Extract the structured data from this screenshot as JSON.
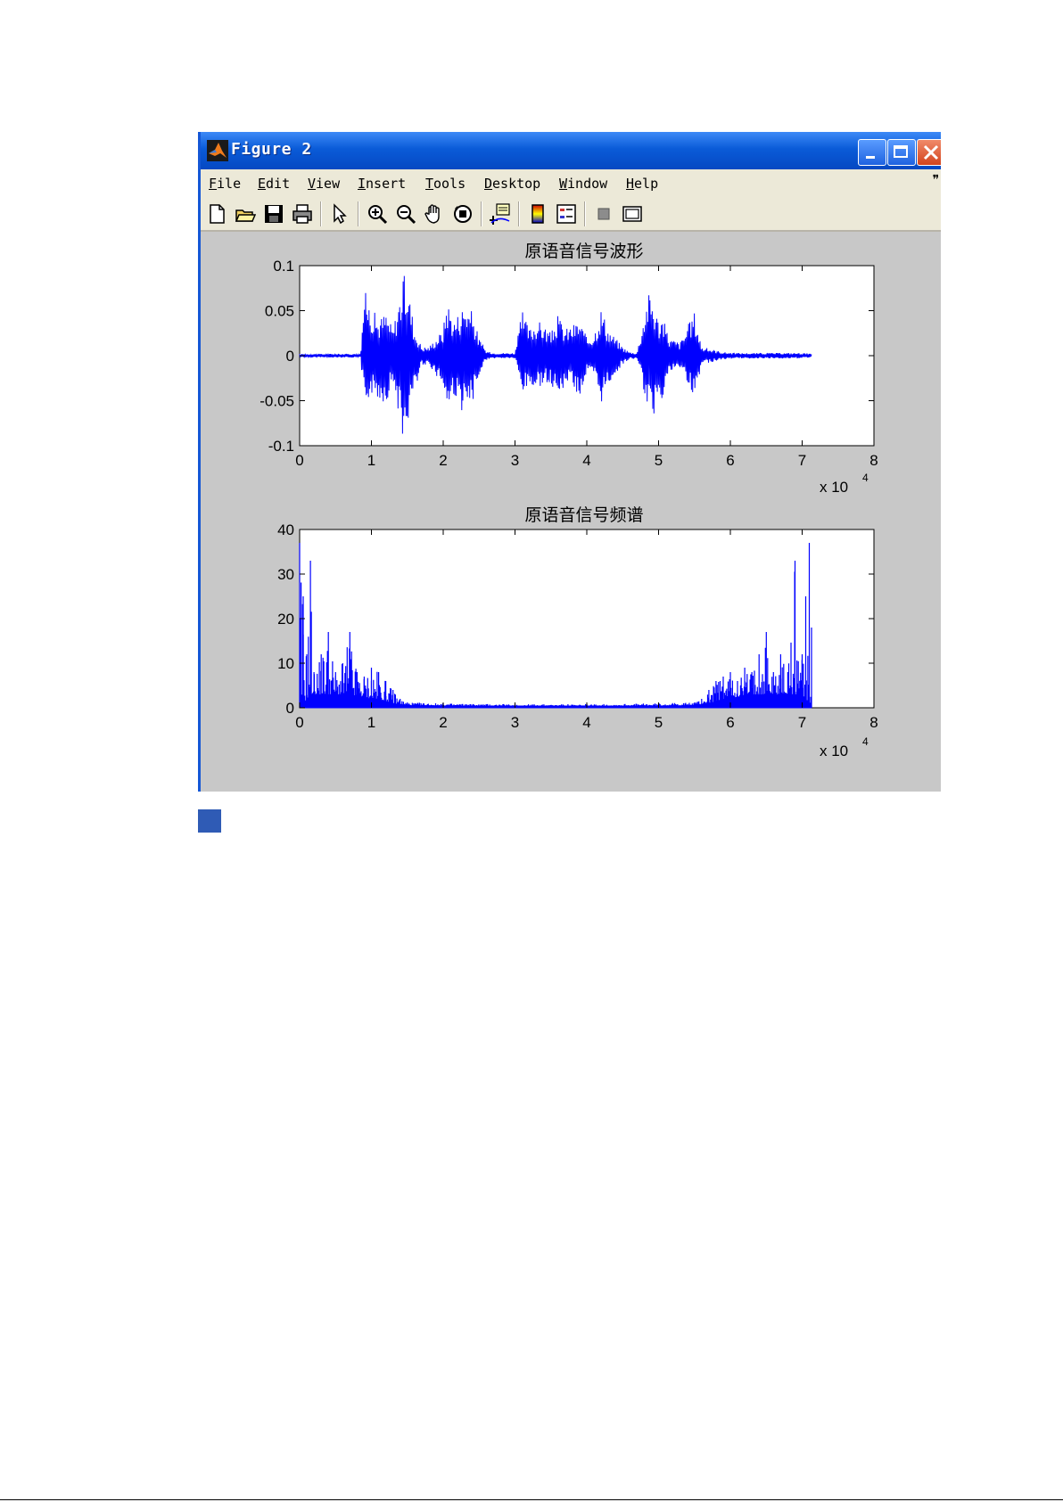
{
  "window": {
    "title": "Figure 2",
    "menu": [
      "File",
      "Edit",
      "View",
      "Insert",
      "Tools",
      "Desktop",
      "Window",
      "Help"
    ],
    "menu_more": "❞",
    "toolbar_icons": [
      "new-figure-icon",
      "open-file-icon",
      "save-icon",
      "print-icon",
      "edit-plot-arrow-icon",
      "zoom-in-icon",
      "zoom-out-icon",
      "pan-hand-icon",
      "rotate-3d-icon",
      "data-cursor-icon",
      "colorbar-icon",
      "legend-icon",
      "hide-plot-tools-icon",
      "show-plot-tools-icon"
    ]
  },
  "colors": {
    "line": "#0000ff",
    "titlebar": "#0a5bd8",
    "figure_bg": "#c8c8c8",
    "menu_bg": "#ece9d8"
  },
  "chart_data": [
    {
      "type": "line",
      "title": "原语音信号波形",
      "xlabel": "",
      "ylabel": "",
      "xlim": [
        0,
        8
      ],
      "ylim": [
        -0.1,
        0.1
      ],
      "xticks": [
        "0",
        "1",
        "2",
        "3",
        "4",
        "5",
        "6",
        "7",
        "8"
      ],
      "yticks": [
        "-0.1",
        "-0.05",
        "0",
        "0.05",
        "0.1"
      ],
      "x_multiplier": "x 10",
      "x_multiplier_exp": "4",
      "envelope": {
        "x": [
          0,
          0.85,
          0.9,
          1.0,
          1.1,
          1.2,
          1.3,
          1.45,
          1.5,
          1.6,
          1.7,
          1.8,
          2.0,
          2.05,
          2.15,
          2.3,
          2.4,
          2.5,
          2.6,
          2.7,
          3.0,
          3.1,
          3.2,
          3.3,
          3.4,
          3.5,
          3.6,
          3.7,
          3.8,
          3.9,
          4.0,
          4.1,
          4.2,
          4.3,
          4.4,
          4.5,
          4.6,
          4.7,
          4.85,
          4.9,
          5.0,
          5.05,
          5.15,
          5.3,
          5.5,
          5.6,
          5.75,
          5.9,
          6.1,
          6.5,
          7.0,
          7.13
        ],
        "upper": [
          0.002,
          0.002,
          0.075,
          0.055,
          0.04,
          0.05,
          0.03,
          0.09,
          0.085,
          0.03,
          0.01,
          0.01,
          0.03,
          0.065,
          0.04,
          0.06,
          0.05,
          0.02,
          0.005,
          0.003,
          0.003,
          0.05,
          0.03,
          0.04,
          0.035,
          0.025,
          0.045,
          0.03,
          0.035,
          0.04,
          0.02,
          0.025,
          0.055,
          0.03,
          0.02,
          0.01,
          0.004,
          0.003,
          0.07,
          0.07,
          0.04,
          0.045,
          0.02,
          0.015,
          0.05,
          0.01,
          0.007,
          0.004,
          0.003,
          0.003,
          0.003,
          0.002
        ],
        "lower": [
          -0.002,
          -0.002,
          -0.055,
          -0.045,
          -0.05,
          -0.055,
          -0.03,
          -0.095,
          -0.08,
          -0.04,
          -0.01,
          -0.01,
          -0.035,
          -0.065,
          -0.045,
          -0.07,
          -0.055,
          -0.02,
          -0.005,
          -0.003,
          -0.003,
          -0.045,
          -0.035,
          -0.04,
          -0.03,
          -0.03,
          -0.05,
          -0.03,
          -0.03,
          -0.05,
          -0.02,
          -0.025,
          -0.055,
          -0.035,
          -0.02,
          -0.01,
          -0.004,
          -0.003,
          -0.06,
          -0.085,
          -0.04,
          -0.05,
          -0.02,
          -0.015,
          -0.045,
          -0.01,
          -0.007,
          -0.004,
          -0.003,
          -0.003,
          -0.003,
          -0.002
        ]
      }
    },
    {
      "type": "line",
      "title": "原语音信号频谱",
      "xlabel": "",
      "ylabel": "",
      "xlim": [
        0,
        8
      ],
      "ylim": [
        0,
        40
      ],
      "xticks": [
        "0",
        "1",
        "2",
        "3",
        "4",
        "5",
        "6",
        "7",
        "8"
      ],
      "yticks": [
        "0",
        "10",
        "20",
        "30",
        "40"
      ],
      "x_multiplier": "x 10",
      "x_multiplier_exp": "4",
      "envelope": {
        "x": [
          0,
          0.05,
          0.1,
          0.15,
          0.2,
          0.3,
          0.4,
          0.5,
          0.6,
          0.7,
          0.8,
          0.9,
          1.0,
          1.1,
          1.2,
          1.3,
          1.4,
          1.5,
          2.0,
          3.0,
          4.0,
          5.0,
          5.5,
          5.6,
          5.7,
          5.8,
          5.9,
          6.0,
          6.1,
          6.2,
          6.3,
          6.4,
          6.5,
          6.6,
          6.7,
          6.8,
          6.9,
          7.0,
          7.05,
          7.1,
          7.13
        ],
        "upper": [
          37,
          25,
          12,
          33,
          8,
          12,
          17,
          8,
          10,
          17,
          8,
          7,
          9,
          8,
          6,
          4,
          2,
          1.2,
          1.0,
          0.8,
          0.8,
          1.0,
          1.2,
          2,
          4,
          6,
          7,
          8,
          6,
          9,
          8,
          12,
          17,
          8,
          12,
          8,
          33,
          12,
          25,
          37,
          18
        ],
        "base": [
          0.5,
          1,
          2,
          3,
          3,
          3,
          3,
          3,
          3,
          3,
          2.5,
          2.5,
          2,
          2,
          1.5,
          1,
          0.8,
          0.6,
          0.5,
          0.4,
          0.4,
          0.5,
          0.6,
          0.8,
          1,
          1.5,
          2,
          2,
          2.5,
          2.5,
          3,
          3,
          3,
          3,
          3,
          3,
          3,
          3,
          2,
          1,
          0.5
        ]
      }
    }
  ]
}
